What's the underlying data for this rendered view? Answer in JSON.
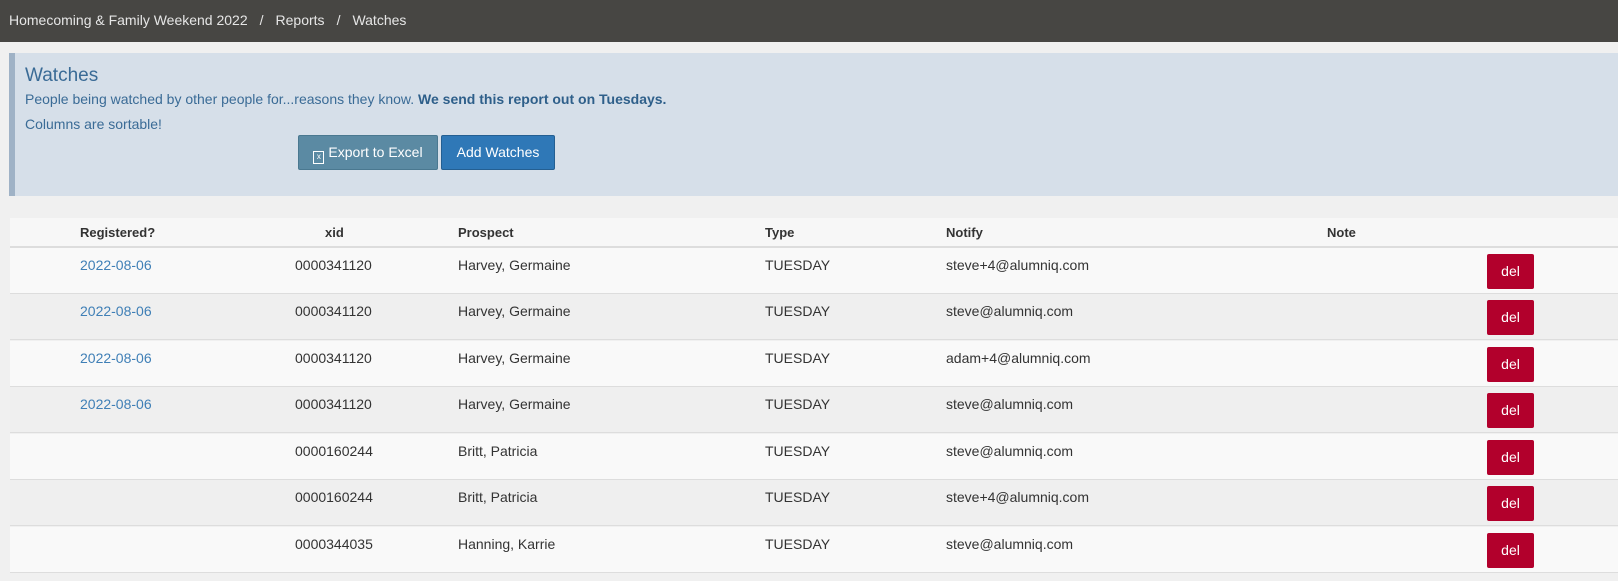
{
  "breadcrumb": {
    "items": [
      "Homecoming & Family Weekend 2022",
      "Reports",
      "Watches"
    ],
    "separator": "/"
  },
  "panel": {
    "title": "Watches",
    "description": "People being watched by other people for...reasons they know.",
    "description_bold": "We send this report out on Tuesdays.",
    "sortable_note": "Columns are sortable!",
    "export_button": "Export to Excel",
    "add_button": "Add Watches"
  },
  "table": {
    "headers": {
      "registered": "Registered?",
      "xid": "xid",
      "prospect": "Prospect",
      "type": "Type",
      "notify": "Notify",
      "note": "Note"
    },
    "delete_label": "del",
    "rows": [
      {
        "registered": "2022-08-06",
        "xid": "0000341120",
        "prospect": "Harvey, Germaine",
        "type": "TUESDAY",
        "notify": "steve+4@alumniq.com",
        "note": ""
      },
      {
        "registered": "2022-08-06",
        "xid": "0000341120",
        "prospect": "Harvey, Germaine",
        "type": "TUESDAY",
        "notify": "steve@alumniq.com",
        "note": ""
      },
      {
        "registered": "2022-08-06",
        "xid": "0000341120",
        "prospect": "Harvey, Germaine",
        "type": "TUESDAY",
        "notify": "adam+4@alumniq.com",
        "note": ""
      },
      {
        "registered": "2022-08-06",
        "xid": "0000341120",
        "prospect": "Harvey, Germaine",
        "type": "TUESDAY",
        "notify": "steve@alumniq.com",
        "note": ""
      },
      {
        "registered": "",
        "xid": "0000160244",
        "prospect": "Britt, Patricia",
        "type": "TUESDAY",
        "notify": "steve@alumniq.com",
        "note": ""
      },
      {
        "registered": "",
        "xid": "0000160244",
        "prospect": "Britt, Patricia",
        "type": "TUESDAY",
        "notify": "steve+4@alumniq.com",
        "note": ""
      },
      {
        "registered": "",
        "xid": "0000344035",
        "prospect": "Hanning, Karrie",
        "type": "TUESDAY",
        "notify": "steve@alumniq.com",
        "note": ""
      }
    ]
  }
}
